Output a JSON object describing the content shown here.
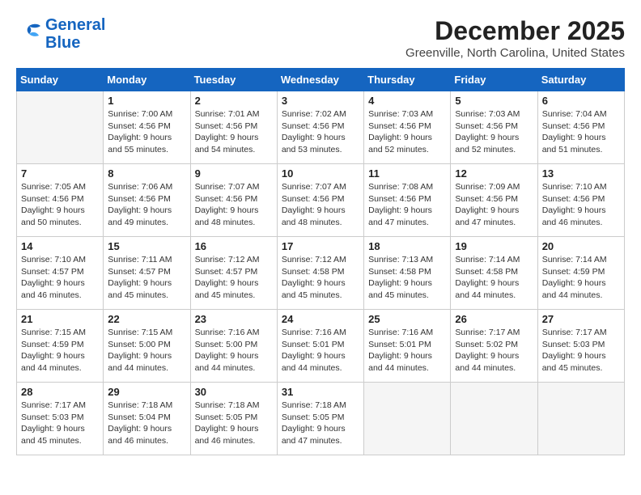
{
  "header": {
    "logo": {
      "line1": "General",
      "line2": "Blue"
    },
    "month": "December 2025",
    "location": "Greenville, North Carolina, United States"
  },
  "weekdays": [
    "Sunday",
    "Monday",
    "Tuesday",
    "Wednesday",
    "Thursday",
    "Friday",
    "Saturday"
  ],
  "weeks": [
    [
      {
        "day": "",
        "info": ""
      },
      {
        "day": "1",
        "info": "Sunrise: 7:00 AM\nSunset: 4:56 PM\nDaylight: 9 hours\nand 55 minutes."
      },
      {
        "day": "2",
        "info": "Sunrise: 7:01 AM\nSunset: 4:56 PM\nDaylight: 9 hours\nand 54 minutes."
      },
      {
        "day": "3",
        "info": "Sunrise: 7:02 AM\nSunset: 4:56 PM\nDaylight: 9 hours\nand 53 minutes."
      },
      {
        "day": "4",
        "info": "Sunrise: 7:03 AM\nSunset: 4:56 PM\nDaylight: 9 hours\nand 52 minutes."
      },
      {
        "day": "5",
        "info": "Sunrise: 7:03 AM\nSunset: 4:56 PM\nDaylight: 9 hours\nand 52 minutes."
      },
      {
        "day": "6",
        "info": "Sunrise: 7:04 AM\nSunset: 4:56 PM\nDaylight: 9 hours\nand 51 minutes."
      }
    ],
    [
      {
        "day": "7",
        "info": "Sunrise: 7:05 AM\nSunset: 4:56 PM\nDaylight: 9 hours\nand 50 minutes."
      },
      {
        "day": "8",
        "info": "Sunrise: 7:06 AM\nSunset: 4:56 PM\nDaylight: 9 hours\nand 49 minutes."
      },
      {
        "day": "9",
        "info": "Sunrise: 7:07 AM\nSunset: 4:56 PM\nDaylight: 9 hours\nand 48 minutes."
      },
      {
        "day": "10",
        "info": "Sunrise: 7:07 AM\nSunset: 4:56 PM\nDaylight: 9 hours\nand 48 minutes."
      },
      {
        "day": "11",
        "info": "Sunrise: 7:08 AM\nSunset: 4:56 PM\nDaylight: 9 hours\nand 47 minutes."
      },
      {
        "day": "12",
        "info": "Sunrise: 7:09 AM\nSunset: 4:56 PM\nDaylight: 9 hours\nand 47 minutes."
      },
      {
        "day": "13",
        "info": "Sunrise: 7:10 AM\nSunset: 4:56 PM\nDaylight: 9 hours\nand 46 minutes."
      }
    ],
    [
      {
        "day": "14",
        "info": "Sunrise: 7:10 AM\nSunset: 4:57 PM\nDaylight: 9 hours\nand 46 minutes."
      },
      {
        "day": "15",
        "info": "Sunrise: 7:11 AM\nSunset: 4:57 PM\nDaylight: 9 hours\nand 45 minutes."
      },
      {
        "day": "16",
        "info": "Sunrise: 7:12 AM\nSunset: 4:57 PM\nDaylight: 9 hours\nand 45 minutes."
      },
      {
        "day": "17",
        "info": "Sunrise: 7:12 AM\nSunset: 4:58 PM\nDaylight: 9 hours\nand 45 minutes."
      },
      {
        "day": "18",
        "info": "Sunrise: 7:13 AM\nSunset: 4:58 PM\nDaylight: 9 hours\nand 45 minutes."
      },
      {
        "day": "19",
        "info": "Sunrise: 7:14 AM\nSunset: 4:58 PM\nDaylight: 9 hours\nand 44 minutes."
      },
      {
        "day": "20",
        "info": "Sunrise: 7:14 AM\nSunset: 4:59 PM\nDaylight: 9 hours\nand 44 minutes."
      }
    ],
    [
      {
        "day": "21",
        "info": "Sunrise: 7:15 AM\nSunset: 4:59 PM\nDaylight: 9 hours\nand 44 minutes."
      },
      {
        "day": "22",
        "info": "Sunrise: 7:15 AM\nSunset: 5:00 PM\nDaylight: 9 hours\nand 44 minutes."
      },
      {
        "day": "23",
        "info": "Sunrise: 7:16 AM\nSunset: 5:00 PM\nDaylight: 9 hours\nand 44 minutes."
      },
      {
        "day": "24",
        "info": "Sunrise: 7:16 AM\nSunset: 5:01 PM\nDaylight: 9 hours\nand 44 minutes."
      },
      {
        "day": "25",
        "info": "Sunrise: 7:16 AM\nSunset: 5:01 PM\nDaylight: 9 hours\nand 44 minutes."
      },
      {
        "day": "26",
        "info": "Sunrise: 7:17 AM\nSunset: 5:02 PM\nDaylight: 9 hours\nand 44 minutes."
      },
      {
        "day": "27",
        "info": "Sunrise: 7:17 AM\nSunset: 5:03 PM\nDaylight: 9 hours\nand 45 minutes."
      }
    ],
    [
      {
        "day": "28",
        "info": "Sunrise: 7:17 AM\nSunset: 5:03 PM\nDaylight: 9 hours\nand 45 minutes."
      },
      {
        "day": "29",
        "info": "Sunrise: 7:18 AM\nSunset: 5:04 PM\nDaylight: 9 hours\nand 46 minutes."
      },
      {
        "day": "30",
        "info": "Sunrise: 7:18 AM\nSunset: 5:05 PM\nDaylight: 9 hours\nand 46 minutes."
      },
      {
        "day": "31",
        "info": "Sunrise: 7:18 AM\nSunset: 5:05 PM\nDaylight: 9 hours\nand 47 minutes."
      },
      {
        "day": "",
        "info": ""
      },
      {
        "day": "",
        "info": ""
      },
      {
        "day": "",
        "info": ""
      }
    ]
  ]
}
